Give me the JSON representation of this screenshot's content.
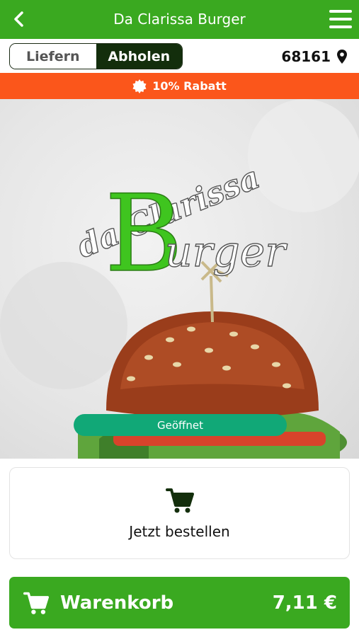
{
  "header": {
    "title": "Da Clarissa Burger",
    "back_icon": "chevron-left-icon",
    "menu_icon": "hamburger-menu-icon"
  },
  "mode_toggle": {
    "options": [
      "Liefern",
      "Abholen"
    ],
    "selected": "Abholen"
  },
  "location": {
    "postal_code": "68161",
    "icon": "map-pin-icon"
  },
  "promo": {
    "label": "10% Rabatt",
    "icon": "badge-icon"
  },
  "hero": {
    "logo_line1": "da Clarissa",
    "logo_initial": "B",
    "logo_rest": "urger",
    "status": "Geöffnet"
  },
  "order_card": {
    "label": "Jetzt bestellen",
    "icon": "shopping-cart-icon"
  },
  "cart_bar": {
    "label": "Warenkorb",
    "total": "7,11 €",
    "icon": "shopping-cart-icon"
  },
  "colors": {
    "brand_green": "#3aa920",
    "promo_orange": "#fb561b",
    "status_teal": "#11a877",
    "toggle_dark": "#132e0c"
  }
}
